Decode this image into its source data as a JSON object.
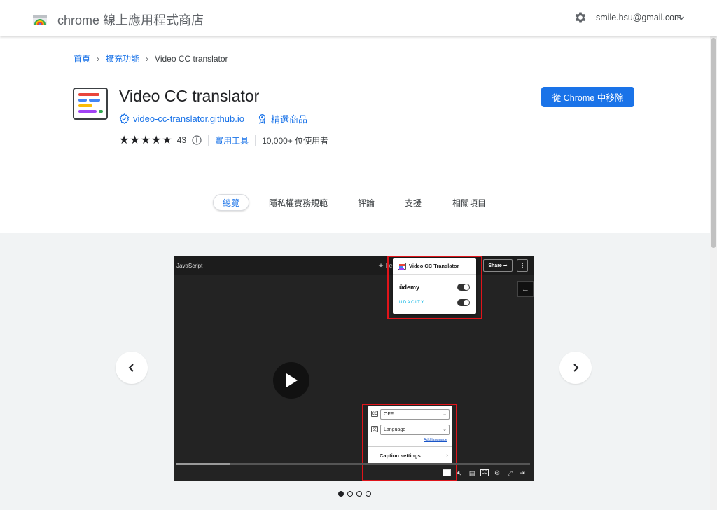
{
  "header": {
    "store_title": "chrome 線上應用程式商店",
    "account_email": "smile.hsu@gmail.com"
  },
  "breadcrumb": {
    "home": "首頁",
    "extensions": "擴充功能",
    "current": "Video CC translator"
  },
  "extension": {
    "name": "Video CC translator",
    "website": "video-cc-translator.github.io",
    "featured_label": "精選商品",
    "stars": "★★★★★",
    "rating_count": "43",
    "category": "實用工具",
    "users": "10,000+ 位使用者",
    "remove_button": "從 Chrome 中移除",
    "icon_colors": [
      "#e8453c",
      "#4285f4",
      "#fbbc04",
      "#a142f4",
      "#34a853"
    ]
  },
  "tabs": [
    {
      "label": "總覽",
      "active": true
    },
    {
      "label": "隱私權實務規範",
      "active": false
    },
    {
      "label": "評論",
      "active": false
    },
    {
      "label": "支援",
      "active": false
    },
    {
      "label": "相關項目",
      "active": false
    }
  ],
  "gallery": {
    "prev_icon": "chevron-left-icon",
    "next_icon": "chevron-right-icon",
    "dots_total": 4,
    "active_dot": 1,
    "screenshot": {
      "course_title": "JavaScript",
      "star_fragment": "★ Le",
      "share_label": "Share ➦",
      "more_label": "⋮",
      "back_arrow": "←",
      "popup_title": "Video CC Translator",
      "udemy_label": "ūdemy",
      "udacity_label": "UDACITY",
      "cc_select_value": "OFF",
      "language_select_value": "Language",
      "add_language": "Add language",
      "caption_settings": "Caption settings",
      "cc_badge": "CC",
      "lang_badge": "文",
      "progress_fraction": 0.15
    }
  }
}
